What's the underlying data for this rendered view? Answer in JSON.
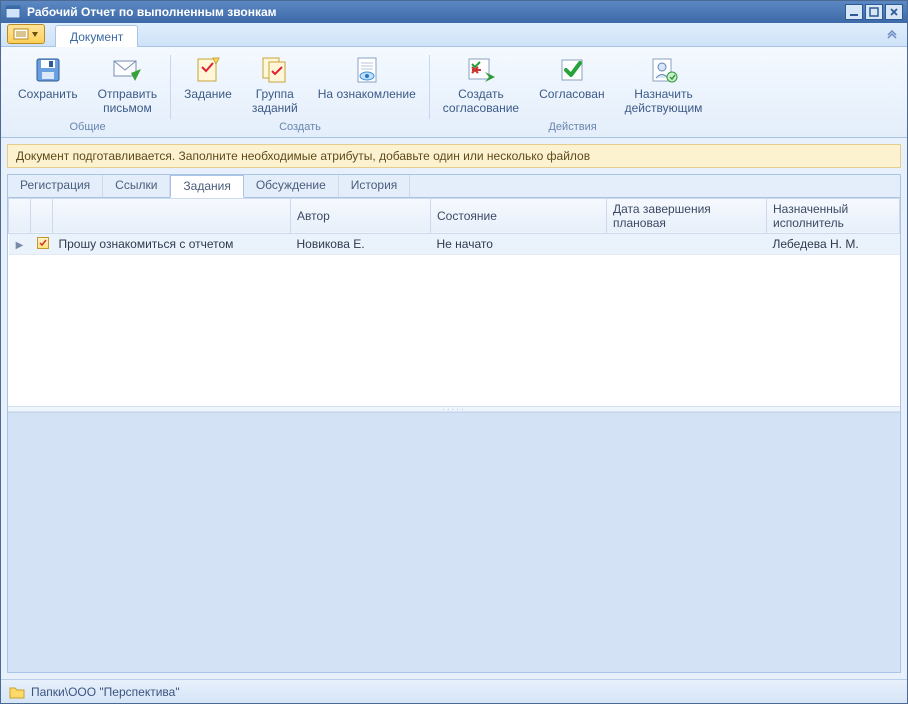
{
  "title": "Рабочий Отчет по выполненным звонкам",
  "ribbon_tab": "Документ",
  "ribbon": {
    "groups": [
      {
        "caption": "Общие",
        "items": [
          {
            "label": "Сохранить"
          },
          {
            "label": "Отправить\nписьмом"
          }
        ]
      },
      {
        "caption": "Создать",
        "items": [
          {
            "label": "Задание"
          },
          {
            "label": "Группа\nзаданий"
          },
          {
            "label": "На ознакомление"
          }
        ]
      },
      {
        "caption": "Действия",
        "items": [
          {
            "label": "Создать\nсогласование"
          },
          {
            "label": "Согласован"
          },
          {
            "label": "Назначить\nдействующим"
          }
        ]
      }
    ]
  },
  "info_banner": "Документ подготавливается. Заполните необходимые атрибуты, добавьте один или несколько файлов",
  "secondary_tabs": [
    "Регистрация",
    "Ссылки",
    "Задания",
    "Обсуждение",
    "История"
  ],
  "active_secondary_tab": "Задания",
  "columns": [
    "",
    "",
    "",
    "Автор",
    "Состояние",
    "Дата завершения плановая",
    "Назначенный исполнитель"
  ],
  "rows": [
    {
      "task": "Прошу ознакомиться с отчетом",
      "author": "Новикова Е.",
      "status": "Не начато",
      "due": "",
      "assignee": "Лебедева Н. М."
    }
  ],
  "status_path": "Папки\\ООО \"Перспектива\""
}
